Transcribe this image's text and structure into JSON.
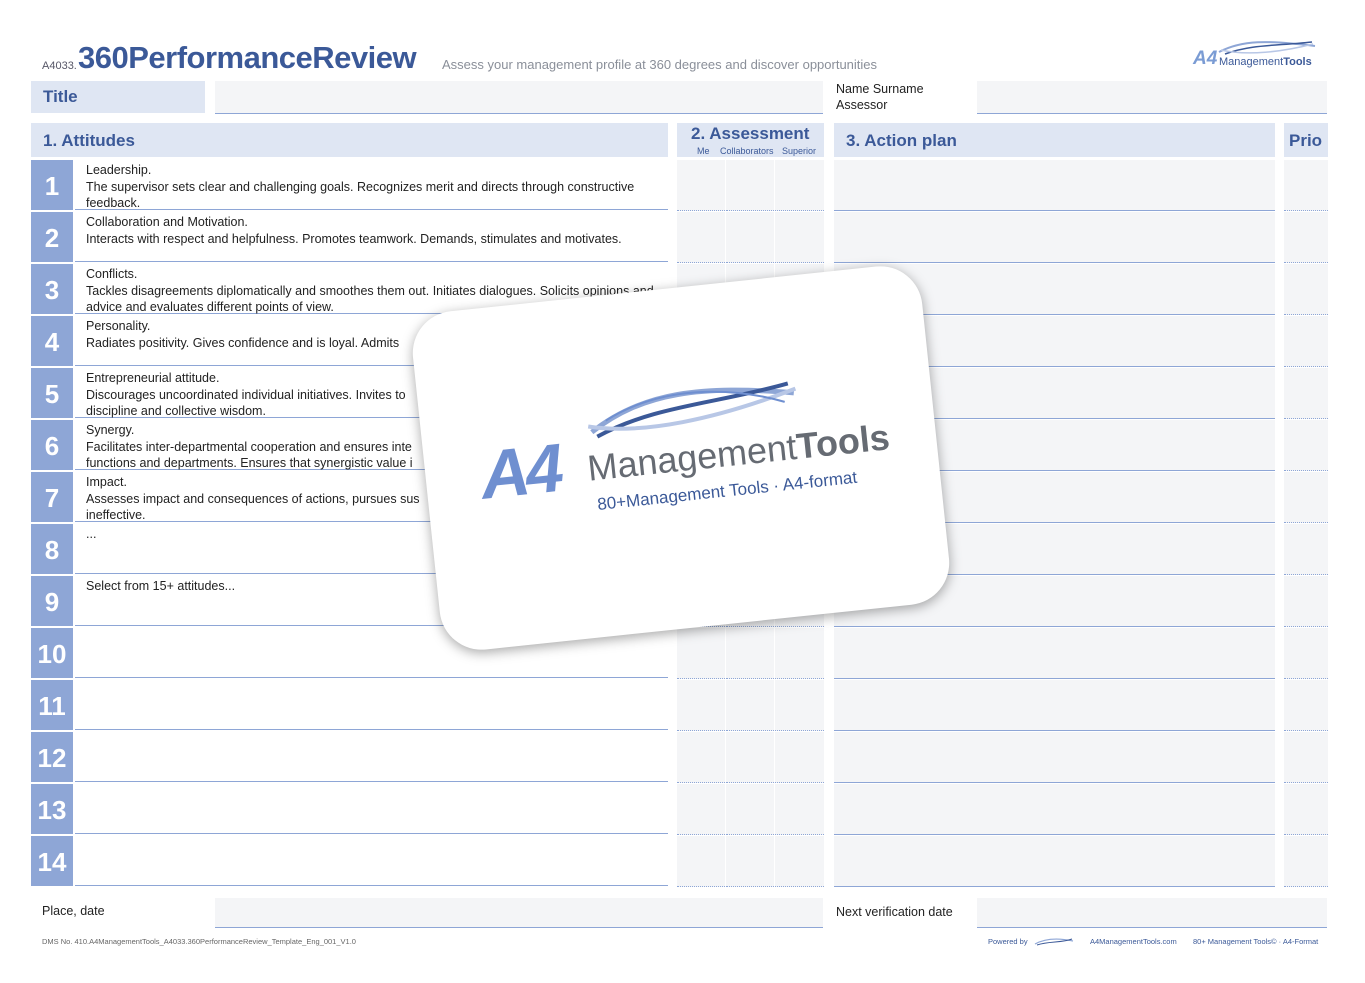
{
  "header": {
    "code": "A4033.",
    "title": "360PerformanceReview",
    "subtitle": "Assess your management profile at 360 degrees and discover opportunities",
    "logo_a4": "A4",
    "logo_mgmt": "Management",
    "logo_tools": "Tools"
  },
  "meta": {
    "title_label": "Title",
    "name_label": "Name Surname",
    "assessor_label": "Assessor"
  },
  "sections": {
    "attitudes": "1. Attitudes",
    "assessment": "2. Assessment",
    "assess_me": "Me",
    "assess_collab": "Collaborators",
    "assess_sup": "Superior",
    "action": "3. Action plan",
    "prio": "Prio"
  },
  "rows": [
    {
      "num": "1",
      "text": "Leadership.\nThe supervisor sets clear and challenging goals. Recognizes merit and directs through constructive feedback."
    },
    {
      "num": "2",
      "text": "Collaboration and Motivation.\nInteracts with respect and helpfulness. Promotes teamwork. Demands, stimulates and motivates."
    },
    {
      "num": "3",
      "text": "Conflicts.\nTackles disagreements diplomatically and smoothes them out. Initiates dialogues. Solicits opinions and advice and evaluates different points of view."
    },
    {
      "num": "4",
      "text": "Personality.\nRadiates positivity. Gives confidence and is loyal. Admits"
    },
    {
      "num": "5",
      "text": "Entrepreneurial attitude.\nDiscourages uncoordinated individual initiatives. Invites to\ndiscipline and collective wisdom."
    },
    {
      "num": "6",
      "text": "Synergy.\nFacilitates inter-departmental cooperation and ensures inte\nfunctions and departments. Ensures that synergistic value i"
    },
    {
      "num": "7",
      "text": "Impact.\nAssesses impact and consequences of actions, pursues sus\nineffective."
    },
    {
      "num": "8",
      "text": "..."
    },
    {
      "num": "9",
      "text": "Select from 15+ attitudes..."
    },
    {
      "num": "10",
      "text": ""
    },
    {
      "num": "11",
      "text": ""
    },
    {
      "num": "12",
      "text": ""
    },
    {
      "num": "13",
      "text": ""
    },
    {
      "num": "14",
      "text": ""
    }
  ],
  "footer": {
    "place_label": "Place, date",
    "next_label": "Next verification date",
    "dms": "DMS No. 410.A4ManagementTools_A4033.360PerformanceReview_Template_Eng_001_V1.0",
    "powered": "Powered by",
    "url": "A4ManagementTools.com",
    "tagline": "80+ Management Tools© · A4-Format"
  },
  "overlay": {
    "a4": "A4",
    "mgmt": "Management",
    "tools": "Tools",
    "tagline": "80+Management Tools · A4-format"
  },
  "colors": {
    "accent": "#3b5998",
    "number_bg": "#8ea6d6",
    "label_bg": "#dfe6f3",
    "field_bg": "#f4f5f7"
  }
}
